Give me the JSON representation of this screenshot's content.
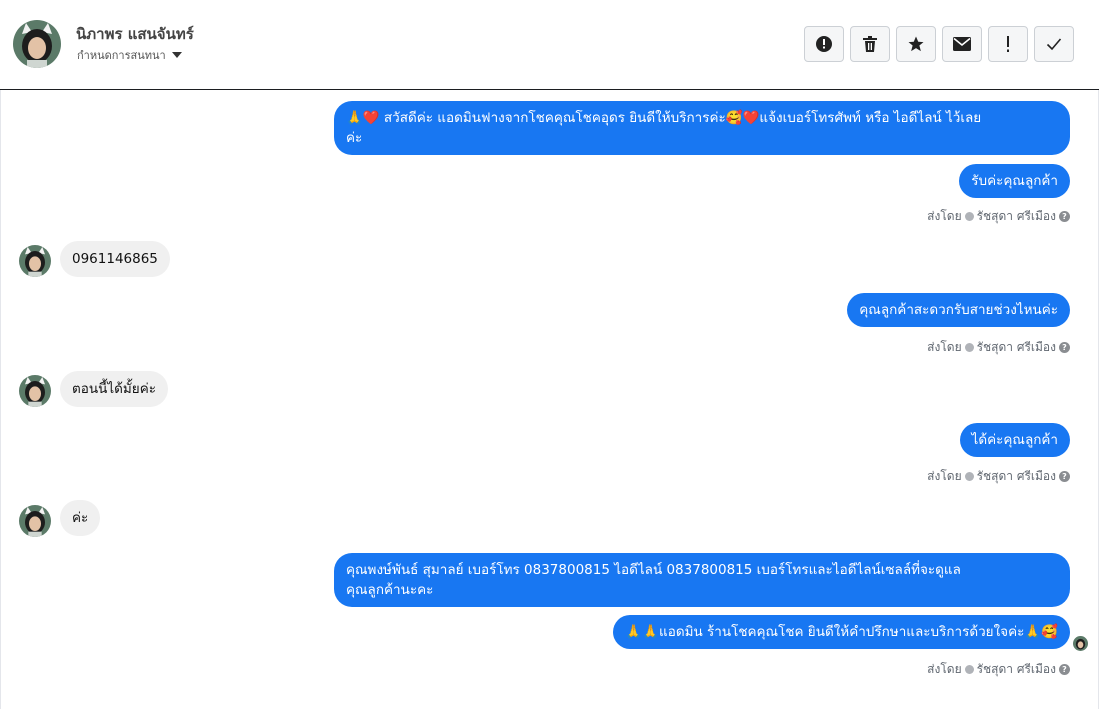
{
  "header": {
    "customer_name": "นิภาพร แสนจันทร์",
    "assign_label": "กำหนดการสนทนา",
    "actions": [
      {
        "name": "report-icon",
        "glyph": "!"
      },
      {
        "name": "trash-icon",
        "glyph": "trash"
      },
      {
        "name": "star-icon",
        "glyph": "star"
      },
      {
        "name": "mail-icon",
        "glyph": "mail"
      },
      {
        "name": "exclamation-icon",
        "glyph": "!"
      },
      {
        "name": "check-icon",
        "glyph": "check"
      }
    ]
  },
  "messages": {
    "m1_line1": "🙏❤️ สวัสดีค่ะ แอดมินฟางจากโชคคุณโชคอุดร ยินดีให้บริการค่ะ🥰❤️แจ้งเบอร์โทรศัพท์ หรือ ไอดีไลน์  ไว้เลย",
    "m1_line2": "ค่ะ",
    "m2": "รับค่ะคุณลูกค้า",
    "sent1_prefix": "ส่งโดย",
    "sent1_name": "รัชสุดา ศรีเมือง",
    "c1": "0961146865",
    "m3": "คุณลูกค้าสะดวกรับสายช่วงไหนค่ะ",
    "sent2_prefix": "ส่งโดย",
    "sent2_name": "รัชสุดา ศรีเมือง",
    "c2": "ตอนนี้ได้มั้ยค่ะ",
    "m4": "ได้ค่ะคุณลูกค้า",
    "sent3_prefix": "ส่งโดย",
    "sent3_name": "รัชสุดา ศรีเมือง",
    "c3": "ค่ะ",
    "m5_line1": "คุณพงษ์พันธ์ สุมาลย์      เบอร์โทร 0837800815  ไอดีไลน์ 0837800815   เบอร์โทรและไอดีไลน์เซลล์ที่จะดูแล",
    "m5_line2": "คุณลูกค้านะคะ",
    "m6": "🙏🙏แอดมิน ร้านโชคคุณโชค ยินดีให้คำปรึกษาและบริการด้วยใจค่ะ🙏🥰",
    "sent4_prefix": "ส่งโดย",
    "sent4_name": "รัชสุดา ศรีเมือง"
  },
  "colors": {
    "accent": "#1877f2",
    "incoming_bubble": "#f0f0f0"
  }
}
